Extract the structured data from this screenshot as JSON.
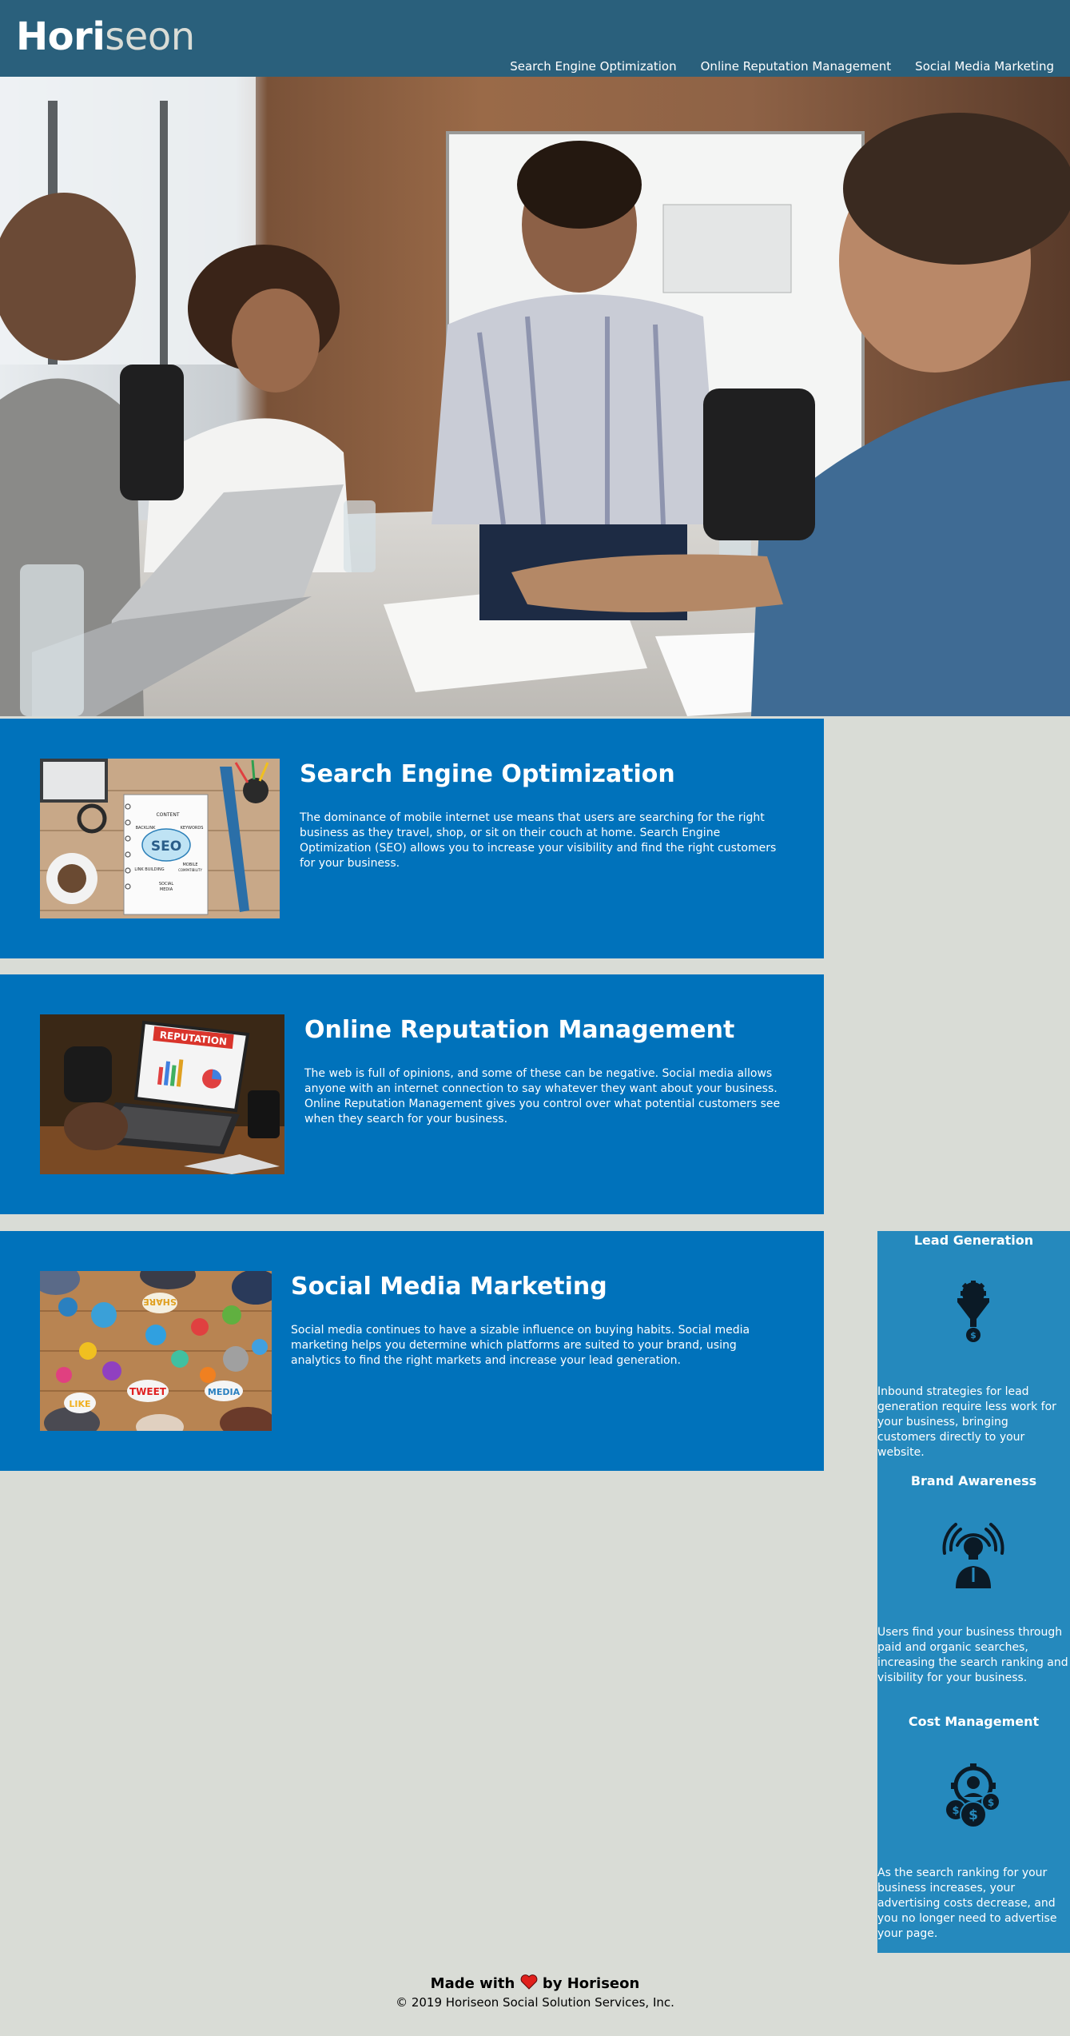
{
  "header": {
    "logo_main": "Hori",
    "logo_accent": "seon",
    "nav": [
      {
        "label": "Search Engine Optimization"
      },
      {
        "label": "Online Reputation Management"
      },
      {
        "label": "Social Media Marketing"
      }
    ]
  },
  "sections": [
    {
      "title": "Search Engine Optimization",
      "body": "The dominance of mobile internet use means that users are searching for the right business as they travel, shop, or sit on their couch at home. Search Engine Optimization (SEO) allows you to increase your visibility and find the right customers for your business."
    },
    {
      "title": "Online Reputation Management",
      "body": "The web is full of opinions, and some of these can be negative. Social media allows anyone with an internet connection to say whatever they want about your business. Online Reputation Management gives you control over what potential customers see when they search for your business."
    },
    {
      "title": "Social Media Marketing",
      "body": "Social media continues to have a sizable influence on buying habits. Social media marketing helps you determine which platforms are suited to your brand, using analytics to find the right markets and increase your lead generation."
    }
  ],
  "seo_image_words": [
    "CONTENT",
    "BACKLINK",
    "KEYWORDS",
    "SEO",
    "MOBILE",
    "COMPATIBILITY",
    "LINK BUILDING",
    "SOCIAL",
    "MEDIA"
  ],
  "reputation_image_word": "REPUTATION",
  "social_image_words": [
    "SHARE",
    "TWEET",
    "LIKE",
    "MEDIA"
  ],
  "benefits": [
    {
      "title": "Lead Generation",
      "icon": "lead-generation-icon",
      "body": "Inbound strategies for lead generation require less work for your business, bringing customers directly to your website."
    },
    {
      "title": "Brand Awareness",
      "icon": "brand-awareness-icon",
      "body": "Users find your business through paid and organic searches, increasing the search ranking and visibility for your business."
    },
    {
      "title": "Cost Management",
      "icon": "cost-management-icon",
      "body": "As the search ranking for your business increases, your advertising costs decrease, and you no longer need to advertise your page."
    }
  ],
  "footer": {
    "made_prefix": "Made with",
    "made_suffix": "by Horiseon",
    "copyright": "© 2019 Horiseon Social Solution Services, Inc."
  },
  "colors": {
    "header_bg": "#2a607c",
    "section_bg": "#0072bb",
    "benefits_bg": "#2589bd",
    "page_bg": "#d9dcd6"
  }
}
